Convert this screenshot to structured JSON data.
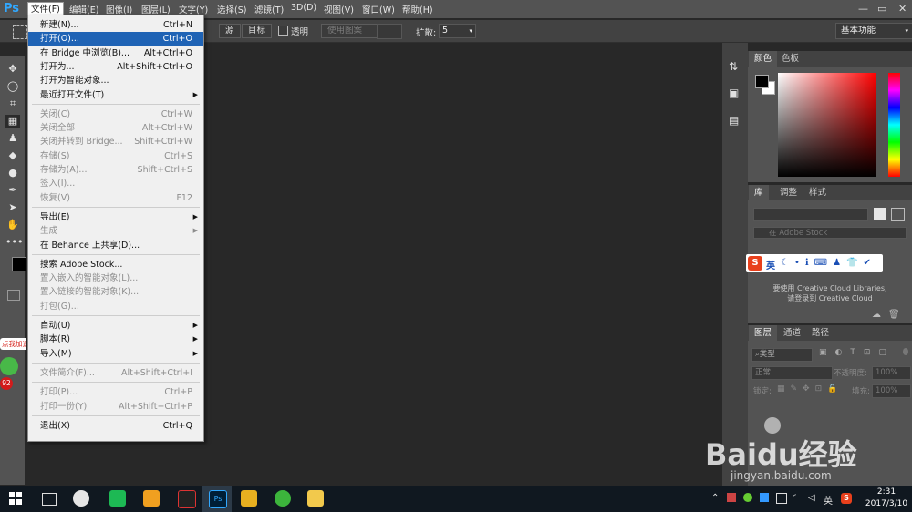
{
  "menubar": {
    "logo": "Ps",
    "items": [
      "文件(F)",
      "编辑(E)",
      "图像(I)",
      "图层(L)",
      "文字(Y)",
      "选择(S)",
      "滤镜(T)",
      "3D(D)",
      "视图(V)",
      "窗口(W)",
      "帮助(H)"
    ],
    "window_controls": {
      "minimize": "—",
      "restore": "▭",
      "close": "✕"
    }
  },
  "options": {
    "source_label": "源",
    "target_label": "目标",
    "transparent_label": "透明",
    "use_pattern_label": "使用图案",
    "spread_label": "扩散:",
    "spread_value": "5",
    "workspace": "基本功能"
  },
  "file_menu": [
    {
      "label": "新建(N)...",
      "shortcut": "Ctrl+N",
      "enabled": true
    },
    {
      "label": "打开(O)...",
      "shortcut": "Ctrl+O",
      "enabled": true,
      "highlighted": true
    },
    {
      "label": "在 Bridge 中浏览(B)...",
      "shortcut": "Alt+Ctrl+O",
      "enabled": true
    },
    {
      "label": "打开为...",
      "shortcut": "Alt+Shift+Ctrl+O",
      "enabled": true
    },
    {
      "label": "打开为智能对象...",
      "shortcut": "",
      "enabled": true
    },
    {
      "label": "最近打开文件(T)",
      "shortcut": "",
      "enabled": true,
      "submenu": true
    },
    {
      "separator": true
    },
    {
      "label": "关闭(C)",
      "shortcut": "Ctrl+W",
      "enabled": false
    },
    {
      "label": "关闭全部",
      "shortcut": "Alt+Ctrl+W",
      "enabled": false
    },
    {
      "label": "关闭并转到 Bridge...",
      "shortcut": "Shift+Ctrl+W",
      "enabled": false
    },
    {
      "label": "存储(S)",
      "shortcut": "Ctrl+S",
      "enabled": false
    },
    {
      "label": "存储为(A)...",
      "shortcut": "Shift+Ctrl+S",
      "enabled": false
    },
    {
      "label": "签入(I)...",
      "shortcut": "",
      "enabled": false
    },
    {
      "label": "恢复(V)",
      "shortcut": "F12",
      "enabled": false
    },
    {
      "separator": true
    },
    {
      "label": "导出(E)",
      "shortcut": "",
      "enabled": true,
      "submenu": true
    },
    {
      "label": "生成",
      "shortcut": "",
      "enabled": false,
      "submenu": true
    },
    {
      "label": "在 Behance 上共享(D)...",
      "shortcut": "",
      "enabled": true
    },
    {
      "separator": true
    },
    {
      "label": "搜索 Adobe Stock...",
      "shortcut": "",
      "enabled": true
    },
    {
      "label": "置入嵌入的智能对象(L)...",
      "shortcut": "",
      "enabled": false
    },
    {
      "label": "置入链接的智能对象(K)...",
      "shortcut": "",
      "enabled": false
    },
    {
      "label": "打包(G)...",
      "shortcut": "",
      "enabled": false
    },
    {
      "separator": true
    },
    {
      "label": "自动(U)",
      "shortcut": "",
      "enabled": true,
      "submenu": true
    },
    {
      "label": "脚本(R)",
      "shortcut": "",
      "enabled": true,
      "submenu": true
    },
    {
      "label": "导入(M)",
      "shortcut": "",
      "enabled": true,
      "submenu": true
    },
    {
      "separator": true
    },
    {
      "label": "文件简介(F)...",
      "shortcut": "Alt+Shift+Ctrl+I",
      "enabled": false
    },
    {
      "separator": true
    },
    {
      "label": "打印(P)...",
      "shortcut": "Ctrl+P",
      "enabled": false
    },
    {
      "label": "打印一份(Y)",
      "shortcut": "Alt+Shift+Ctrl+P",
      "enabled": false
    },
    {
      "separator": true
    },
    {
      "label": "退出(X)",
      "shortcut": "Ctrl+Q",
      "enabled": true
    }
  ],
  "panels": {
    "color_tabs": [
      "颜色",
      "色板"
    ],
    "library_tabs": [
      "库",
      "调整",
      "样式"
    ],
    "library_search_placeholder": "在 Adobe Stock",
    "library_message_line1": "要使用 Creative Cloud Libraries,",
    "library_message_line2": "请登录到 Creative Cloud",
    "layers_tabs": [
      "图层",
      "通道",
      "路径"
    ],
    "layers_filter_kind": "类型",
    "blend_mode": "正常",
    "opacity_label": "不透明度:",
    "opacity_value": "100%",
    "lock_label": "锁定:",
    "fill_label": "填充:",
    "fill_value": "100%"
  },
  "ime_bar": {
    "lang": "英"
  },
  "sidebar_badge": {
    "label": "点我加速",
    "count": "92"
  },
  "watermark": {
    "brand": "Baidu经验",
    "url": "jingyan.baidu.com"
  },
  "taskbar": {
    "time": "2:31",
    "date": "2017/3/10",
    "ime": "英"
  },
  "colors": {
    "accent": "#1f63b5",
    "ps_blue": "#31a8ff",
    "menu_bg": "#f0f0f0"
  }
}
